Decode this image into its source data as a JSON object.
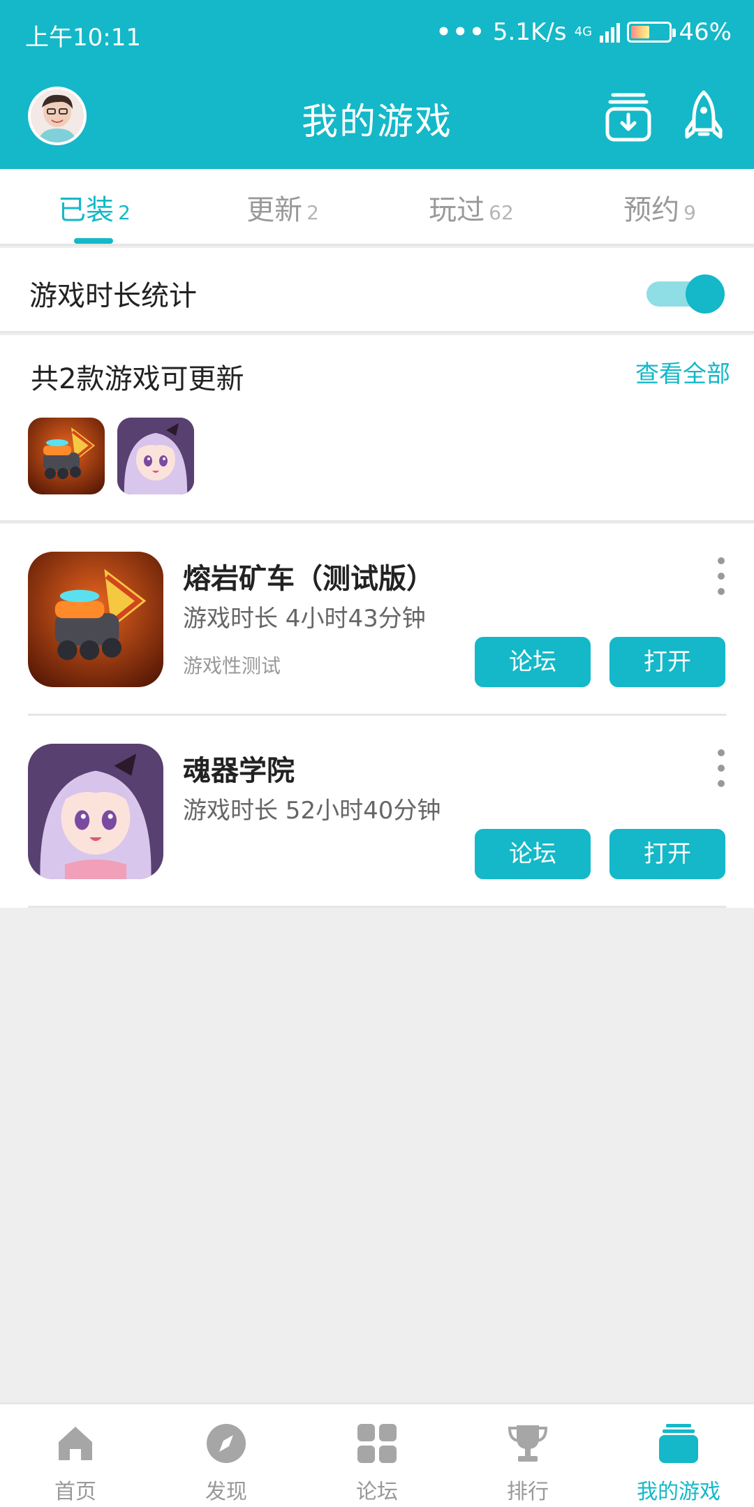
{
  "status_bar": {
    "time": "上午10:11",
    "dots": "•••",
    "speed": "5.1K/s",
    "network": "4G",
    "battery": "46%"
  },
  "header": {
    "title": "我的游戏",
    "download_icon": "download-box-icon",
    "rocket_icon": "rocket-icon"
  },
  "tabs": [
    {
      "label": "已装",
      "count": "2",
      "active": true
    },
    {
      "label": "更新",
      "count": "2",
      "active": false
    },
    {
      "label": "玩过",
      "count": "62",
      "active": false
    },
    {
      "label": "预约",
      "count": "9",
      "active": false
    }
  ],
  "stats_row": {
    "label": "游戏时长统计",
    "toggle_on": true
  },
  "update_panel": {
    "title": "共2款游戏可更新",
    "view_all": "查看全部"
  },
  "games": [
    {
      "name": "熔岩矿车（测试版）",
      "time": "游戏时长 4小时43分钟",
      "tag": "游戏性测试",
      "forum_label": "论坛",
      "open_label": "打开"
    },
    {
      "name": "魂器学院",
      "time": "游戏时长 52小时40分钟",
      "tag": "",
      "forum_label": "论坛",
      "open_label": "打开"
    }
  ],
  "bottom_nav": [
    {
      "label": "首页",
      "icon": "home-icon",
      "active": false
    },
    {
      "label": "发现",
      "icon": "compass-icon",
      "active": false
    },
    {
      "label": "论坛",
      "icon": "grid-icon",
      "active": false
    },
    {
      "label": "排行",
      "icon": "trophy-icon",
      "active": false
    },
    {
      "label": "我的游戏",
      "icon": "games-stack-icon",
      "active": true
    }
  ],
  "colors": {
    "accent": "#14b8c8",
    "background": "#eeeeee"
  }
}
